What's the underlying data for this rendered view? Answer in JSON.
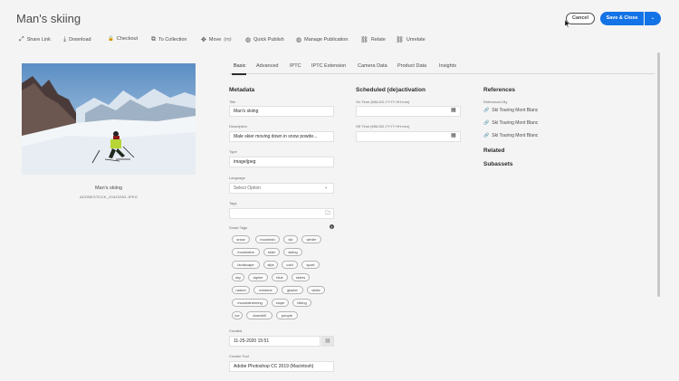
{
  "header": {
    "title": "Man's skiing",
    "cancel_label": "Cancel",
    "save_label": "Save & Close",
    "dropdown_glyph": "⌄"
  },
  "toolbar": {
    "items": [
      {
        "label": "Share Link",
        "icon": "share-icon",
        "glyph": "⤢"
      },
      {
        "label": "Download",
        "icon": "download-icon",
        "glyph": "⤓"
      },
      {
        "label": "Checkout",
        "icon": "lock-icon",
        "glyph": "🔒"
      },
      {
        "label": "To Collection",
        "icon": "collection-icon",
        "glyph": "⧉"
      },
      {
        "label": "Move",
        "shortcut": "(m)",
        "icon": "move-icon",
        "glyph": "✥"
      },
      {
        "label": "Quick Publish",
        "icon": "globe-icon",
        "glyph": "◍"
      },
      {
        "label": "Manage Publication",
        "icon": "globe-settings-icon",
        "glyph": "◍"
      },
      {
        "label": "Relate",
        "icon": "link-icon",
        "glyph": "⛓"
      },
      {
        "label": "Unrelate",
        "icon": "unlink-icon",
        "glyph": "⛓"
      }
    ]
  },
  "asset": {
    "title": "Man's skiing",
    "filename": "ADOBESTOCK_20423353.JPEG"
  },
  "tabs": [
    {
      "label": "Basic",
      "active": true
    },
    {
      "label": "Advanced"
    },
    {
      "label": "IPTC"
    },
    {
      "label": "IPTC Extension"
    },
    {
      "label": "Camera Data"
    },
    {
      "label": "Product Data"
    },
    {
      "label": "Insights"
    }
  ],
  "metadata": {
    "section_title": "Metadata",
    "title_label": "Title",
    "title_value": "Man's skiing",
    "description_label": "Description",
    "description_value": "Male skier moving down in snow powde...",
    "type_label": "Type",
    "type_value": "image/jpeg",
    "language_label": "Language",
    "language_placeholder": "Select Option",
    "tags_label": "Tags",
    "smart_tags_label": "Smart Tags",
    "smart_tags": [
      "snow",
      "mountain",
      "ski",
      "winter",
      "mountains",
      "skier",
      "skiing",
      "landscape",
      "alps",
      "cold",
      "sport",
      "sky",
      "alpine",
      "blue",
      "skiers",
      "nature",
      "extreme",
      "glacier",
      "white",
      "mountaineering",
      "slope",
      "hiking",
      "ice",
      "downhill",
      "people"
    ],
    "created_label": "Created",
    "created_value": "11-25-2020 15:51",
    "creator_tool_label": "Creator Tool",
    "creator_tool_value": "Adobe Photoshop CC 2019 (Macintosh)"
  },
  "scheduled": {
    "section_title": "Scheduled (de)activation",
    "on_time_label": "On Time (MM-DD-YYYY HH:mm)",
    "off_time_label": "Off Time (MM-DD-YYYY HH:mm)"
  },
  "references": {
    "section_title": "References",
    "referenced_by_label": "Referenced By",
    "items": [
      "Ski Touring Mont Blanc",
      "Ski Touring Mont Blanc",
      "Ski Touring Mont Blanc"
    ],
    "related_title": "Related",
    "subassets_title": "Subassets"
  }
}
